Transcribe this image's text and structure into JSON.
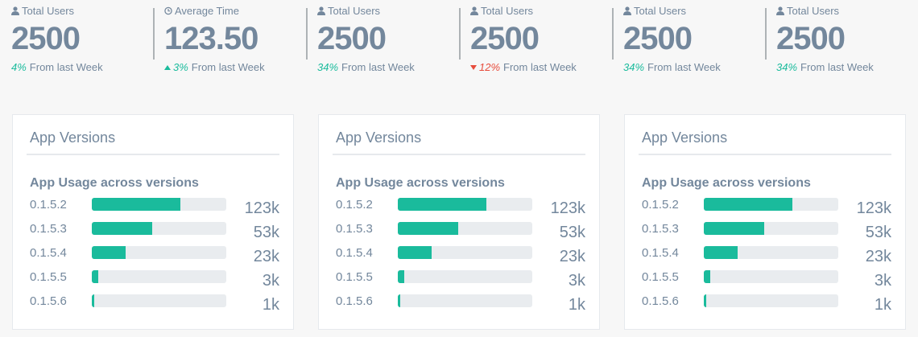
{
  "stats": [
    {
      "icon": "user-icon",
      "label": "Total Users",
      "count": "2500",
      "pct": "4%",
      "trend": "up",
      "arrow": false,
      "foot": "From last Week"
    },
    {
      "icon": "clock-icon",
      "label": "Average Time",
      "count": "123.50",
      "pct": "3%",
      "trend": "up",
      "arrow": true,
      "foot": "From last Week"
    },
    {
      "icon": "user-icon",
      "label": "Total Users",
      "count": "2500",
      "pct": "34%",
      "trend": "up",
      "arrow": false,
      "foot": "From last Week"
    },
    {
      "icon": "user-icon",
      "label": "Total Users",
      "count": "2500",
      "pct": "12%",
      "trend": "down",
      "arrow": true,
      "foot": "From last Week"
    },
    {
      "icon": "user-icon",
      "label": "Total Users",
      "count": "2500",
      "pct": "34%",
      "trend": "up",
      "arrow": false,
      "foot": "From last Week"
    },
    {
      "icon": "user-icon",
      "label": "Total Users",
      "count": "2500",
      "pct": "34%",
      "trend": "up",
      "arrow": false,
      "foot": "From last Week"
    }
  ],
  "panels": [
    {
      "title": "App Versions",
      "subtitle": "App Usage across versions",
      "rows": [
        {
          "version": "0.1.5.2",
          "value": "123k",
          "fill": 0.66
        },
        {
          "version": "0.1.5.3",
          "value": "53k",
          "fill": 0.45
        },
        {
          "version": "0.1.5.4",
          "value": "23k",
          "fill": 0.25
        },
        {
          "version": "0.1.5.5",
          "value": "3k",
          "fill": 0.05
        },
        {
          "version": "0.1.5.6",
          "value": "1k",
          "fill": 0.02
        }
      ]
    },
    {
      "title": "App Versions",
      "subtitle": "App Usage across versions",
      "rows": [
        {
          "version": "0.1.5.2",
          "value": "123k",
          "fill": 0.66
        },
        {
          "version": "0.1.5.3",
          "value": "53k",
          "fill": 0.45
        },
        {
          "version": "0.1.5.4",
          "value": "23k",
          "fill": 0.25
        },
        {
          "version": "0.1.5.5",
          "value": "3k",
          "fill": 0.05
        },
        {
          "version": "0.1.5.6",
          "value": "1k",
          "fill": 0.02
        }
      ]
    },
    {
      "title": "App Versions",
      "subtitle": "App Usage across versions",
      "rows": [
        {
          "version": "0.1.5.2",
          "value": "123k",
          "fill": 0.66
        },
        {
          "version": "0.1.5.3",
          "value": "53k",
          "fill": 0.45
        },
        {
          "version": "0.1.5.4",
          "value": "23k",
          "fill": 0.25
        },
        {
          "version": "0.1.5.5",
          "value": "3k",
          "fill": 0.05
        },
        {
          "version": "0.1.5.6",
          "value": "1k",
          "fill": 0.02
        }
      ]
    }
  ],
  "colors": {
    "accent": "#1abb9c",
    "down": "#e74c3c",
    "text": "#73879c",
    "track": "#e9ecef"
  }
}
